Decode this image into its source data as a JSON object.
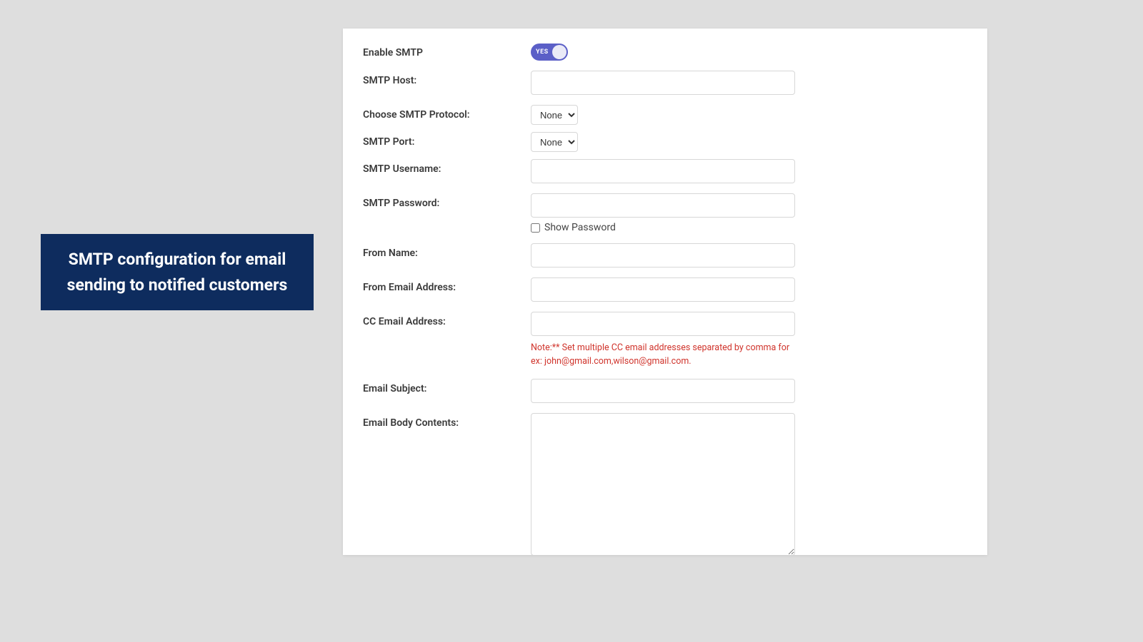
{
  "callout": {
    "text": "SMTP configuration for email sending to notified customers"
  },
  "form": {
    "enable_smtp": {
      "label": "Enable SMTP",
      "toggle_text": "YES",
      "value": true
    },
    "smtp_host": {
      "label": "SMTP Host:",
      "value": ""
    },
    "smtp_protocol": {
      "label": "Choose SMTP Protocol:",
      "selected": "None"
    },
    "smtp_port": {
      "label": "SMTP Port:",
      "selected": "None"
    },
    "smtp_username": {
      "label": "SMTP Username:",
      "value": ""
    },
    "smtp_password": {
      "label": "SMTP Password:",
      "value": "",
      "show_password_label": "Show Password",
      "show_password_checked": false
    },
    "from_name": {
      "label": "From Name:",
      "value": ""
    },
    "from_email": {
      "label": "From Email Address:",
      "value": ""
    },
    "cc_email": {
      "label": "CC Email Address:",
      "value": "",
      "note": "Note:** Set multiple CC email addresses separated by comma for ex: john@gmail.com,wilson@gmail.com."
    },
    "email_subject": {
      "label": "Email Subject:",
      "value": ""
    },
    "email_body": {
      "label": "Email Body Contents:",
      "value": ""
    }
  }
}
